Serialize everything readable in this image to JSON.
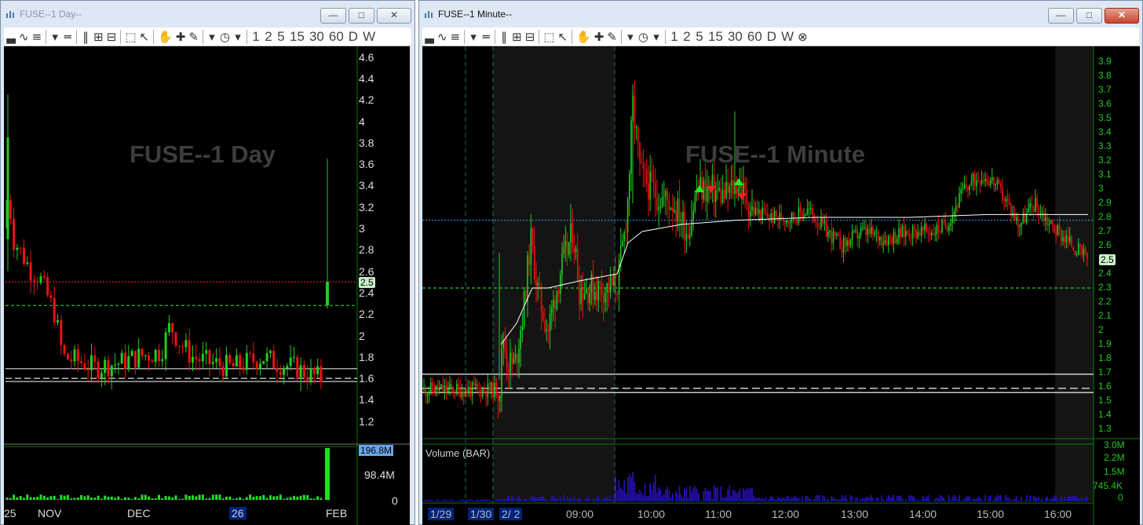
{
  "colors": {
    "up": "#22cc22",
    "down": "#ee1111",
    "frame": "#0a7a0a",
    "volume": "#2a10c8",
    "daily_volume": "#22dd22",
    "vwap": "#ffffff",
    "level_green": "#22cc22",
    "level_red": "#cc2222",
    "level_blue": "#2a8ad8"
  },
  "window_day": {
    "title": "FUSE--1 Day--",
    "watermark": "FUSE--1 Day",
    "y_ticks": [
      "4.6",
      "4.4",
      "4.2",
      "4",
      "3.8",
      "3.6",
      "3.4",
      "3.2",
      "3",
      "2.8",
      "2.6",
      "2.4",
      "2.2",
      "2",
      "1.8",
      "1.6",
      "1.4",
      "1.2"
    ],
    "price_tag": "2.5",
    "volume_tag": "196.8M",
    "volume_ticks": [
      "98.4M",
      "0"
    ],
    "x_labels": [
      "25",
      "NOV",
      "DEC",
      "26",
      "FEB"
    ]
  },
  "window_minute": {
    "title": "FUSE--1 Minute--",
    "watermark": "FUSE--1 Minute",
    "y_ticks": [
      "3.9",
      "3.8",
      "3.7",
      "3.6",
      "3.5",
      "3.4",
      "3.3",
      "3.2",
      "3.1",
      "3",
      "2.9",
      "2.8",
      "2.7",
      "2.6",
      "2.5",
      "2.4",
      "2.3",
      "2.2",
      "2.1",
      "2",
      "1.9",
      "1.8",
      "1.7",
      "1.6",
      "1.5",
      "1.4",
      "1.3"
    ],
    "price_tag": "2.5",
    "volume_label": "Volume (BAR)",
    "volume_ticks": [
      "3.0M",
      "2.2M",
      "1.5M",
      "745.4K",
      "0"
    ],
    "x_labels": [
      "1/29",
      "1/30",
      "2/ 2",
      "09:00",
      "10:00",
      "11:00",
      "12:00",
      "13:00",
      "14:00",
      "15:00",
      "16:00"
    ]
  },
  "toolbar": {
    "icons": [
      "chart-type-icon",
      "chart-style-icon",
      "indicator-icon",
      "dropdown-icon",
      "hline-icon",
      "vline-icon",
      "zoom-in-icon",
      "zoom-out-icon",
      "zoom-fit-icon",
      "pointer-icon",
      "hand-icon",
      "crosshair-icon",
      "pencil-icon",
      "draw-dropdown-icon",
      "clock-icon",
      "clock-dropdown-icon"
    ],
    "timeframes": [
      "1",
      "2",
      "5",
      "15",
      "30",
      "60",
      "D",
      "W"
    ]
  },
  "chart_data": [
    {
      "type": "candlestick",
      "title": "FUSE--1 Day",
      "ylim": [
        1.0,
        4.7
      ],
      "x_labels": [
        "25",
        "NOV",
        "DEC",
        "26",
        "FEB"
      ],
      "levels": [
        {
          "price": 2.5,
          "style": "red dotted"
        },
        {
          "price": 2.28,
          "style": "green dashed"
        },
        {
          "price": 1.69,
          "style": "white solid"
        },
        {
          "price": 1.6,
          "style": "white dashed"
        },
        {
          "price": 1.57,
          "style": "white solid"
        }
      ],
      "last_price": 2.5,
      "max_volume": "196.8M"
    },
    {
      "type": "candlestick",
      "title": "FUSE--1 Minute",
      "ylim": [
        1.25,
        4.0
      ],
      "x_labels": [
        "1/29",
        "1/30",
        "2/ 2",
        "09:00",
        "10:00",
        "11:00",
        "12:00",
        "13:00",
        "14:00",
        "15:00",
        "16:00"
      ],
      "levels": [
        {
          "price": 2.78,
          "style": "blue dotted"
        },
        {
          "price": 2.3,
          "style": "green dashed"
        },
        {
          "price": 1.69,
          "style": "white solid"
        },
        {
          "price": 1.59,
          "style": "white dashed"
        },
        {
          "price": 1.56,
          "style": "white solid"
        }
      ],
      "last_price": 2.5,
      "volume_max": "3.0M",
      "path": [
        [
          0,
          1.58
        ],
        [
          95,
          1.58
        ],
        [
          100,
          1.62
        ],
        [
          102,
          2.0
        ],
        [
          108,
          1.78
        ],
        [
          118,
          1.75
        ],
        [
          130,
          2.2
        ],
        [
          138,
          2.65
        ],
        [
          148,
          2.25
        ],
        [
          160,
          2.0
        ],
        [
          175,
          2.4
        ],
        [
          192,
          2.7
        ],
        [
          200,
          2.3
        ],
        [
          215,
          2.3
        ],
        [
          235,
          2.3
        ],
        [
          248,
          2.32
        ],
        [
          258,
          2.7
        ],
        [
          262,
          2.95
        ],
        [
          268,
          3.6
        ],
        [
          278,
          3.1
        ],
        [
          300,
          2.95
        ],
        [
          320,
          2.9
        ],
        [
          338,
          2.7
        ],
        [
          350,
          3.0
        ],
        [
          368,
          3.0
        ],
        [
          385,
          2.95
        ],
        [
          402,
          3.05
        ],
        [
          420,
          2.85
        ],
        [
          442,
          2.8
        ],
        [
          470,
          2.8
        ],
        [
          492,
          2.85
        ],
        [
          515,
          2.7
        ],
        [
          535,
          2.6
        ],
        [
          560,
          2.7
        ],
        [
          590,
          2.65
        ],
        [
          620,
          2.7
        ],
        [
          650,
          2.7
        ],
        [
          668,
          2.75
        ],
        [
          690,
          3.0
        ],
        [
          712,
          3.1
        ],
        [
          728,
          3.05
        ],
        [
          745,
          2.9
        ],
        [
          760,
          2.75
        ],
        [
          780,
          2.9
        ],
        [
          800,
          2.75
        ],
        [
          820,
          2.65
        ],
        [
          838,
          2.55
        ],
        [
          848,
          2.5
        ]
      ],
      "vwap": [
        [
          100,
          1.9
        ],
        [
          120,
          2.05
        ],
        [
          140,
          2.3
        ],
        [
          160,
          2.3
        ],
        [
          200,
          2.35
        ],
        [
          248,
          2.4
        ],
        [
          262,
          2.62
        ],
        [
          280,
          2.7
        ],
        [
          330,
          2.75
        ],
        [
          400,
          2.78
        ],
        [
          500,
          2.8
        ],
        [
          620,
          2.8
        ],
        [
          720,
          2.82
        ],
        [
          848,
          2.82
        ]
      ],
      "signals": [
        {
          "x": 353,
          "price": 3.0,
          "dir": "up"
        },
        {
          "x": 368,
          "price": 3.0,
          "dir": "down"
        },
        {
          "x": 403,
          "price": 3.05,
          "dir": "up"
        },
        {
          "x": 407,
          "price": 2.95,
          "dir": "down"
        }
      ]
    }
  ]
}
